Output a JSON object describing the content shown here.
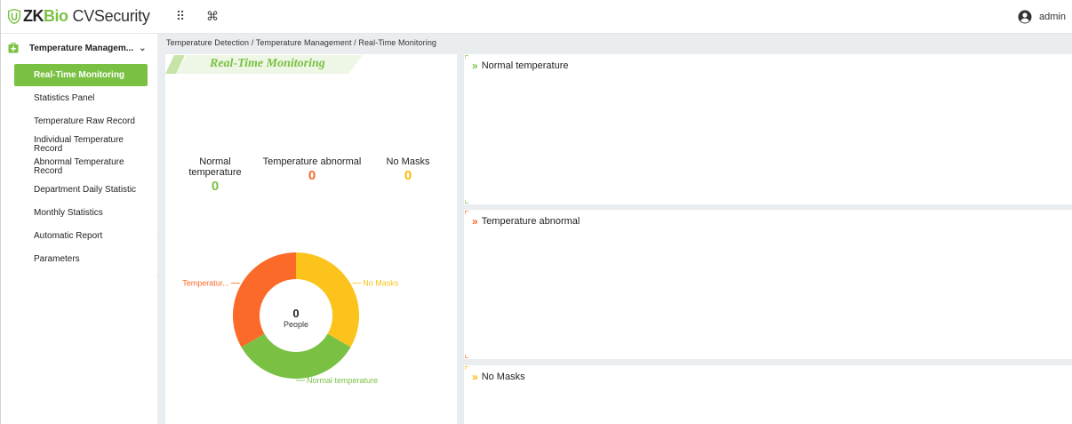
{
  "app": {
    "logo_zk": "ZK",
    "logo_bio": "Bio",
    "logo_product": "CVSecurity",
    "username": "admin"
  },
  "icons": {
    "apps_grid": "⠿",
    "shortcuts": "⌘"
  },
  "sidebar": {
    "module_label": "Temperature Managem...",
    "items": [
      {
        "label": "Real-Time Monitoring",
        "active": true
      },
      {
        "label": "Statistics Panel"
      },
      {
        "label": "Temperature Raw Record"
      },
      {
        "label": "Individual Temperature Record"
      },
      {
        "label": "Abnormal Temperature Record"
      },
      {
        "label": "Department Daily Statistic"
      },
      {
        "label": "Monthly Statistics"
      },
      {
        "label": "Automatic Report"
      },
      {
        "label": "Parameters"
      }
    ],
    "collapse_glyph": "«"
  },
  "breadcrumb": "Temperature Detection / Temperature Management / Real-Time Monitoring",
  "monitor": {
    "title": "Real-Time Monitoring",
    "stats": [
      {
        "label": "Normal temperature",
        "value": "0",
        "color": "#7ac143"
      },
      {
        "label": "Temperature abnormal",
        "value": "0",
        "color": "#f4692a"
      },
      {
        "label": "No Masks",
        "value": "0",
        "color": "#f6b800"
      }
    ]
  },
  "chart_data": {
    "type": "pie",
    "center_value": "0",
    "center_label": "People",
    "slices": [
      {
        "name": "No Masks",
        "display_label": "No Masks",
        "share": 0.3333,
        "color": "#fbc31b"
      },
      {
        "name": "Normal temperature",
        "display_label": "Normal temperature",
        "share": 0.3333,
        "color": "#7ac143"
      },
      {
        "name": "Temperature abnormal",
        "display_label": "Temperatur...",
        "share": 0.3333,
        "color": "#fb6a29"
      }
    ]
  },
  "panels": [
    {
      "title": "Normal temperature",
      "arrow_color": "#7ac143"
    },
    {
      "title": "Temperature abnormal",
      "arrow_color": "#f4692a"
    },
    {
      "title": "No Masks",
      "arrow_color": "#f6b800"
    }
  ]
}
